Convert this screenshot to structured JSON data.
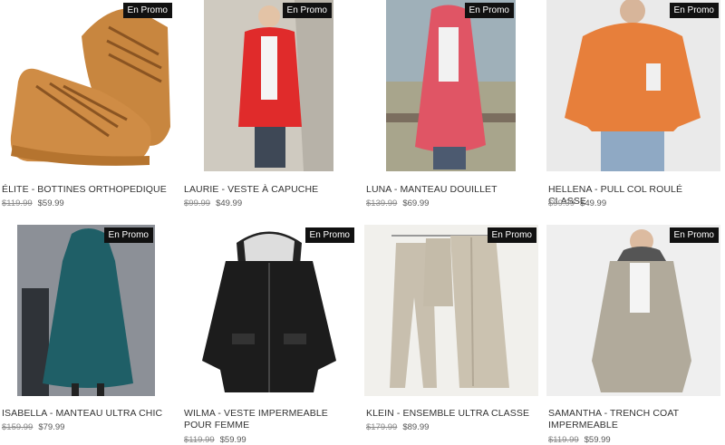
{
  "badge_label": "En Promo",
  "products": [
    {
      "title": "ÉLITE - BOTTINES ORTHOPEDIQUE",
      "old_price": "$119.99",
      "new_price": "$59.99"
    },
    {
      "title": "LAURIE - VESTE À CAPUCHE",
      "old_price": "$99.99",
      "new_price": "$49.99"
    },
    {
      "title": "LUNA - MANTEAU DOUILLET",
      "old_price": "$139.99",
      "new_price": "$69.99"
    },
    {
      "title": "HELLENA - PULL COL ROULÉ CLASSE",
      "old_price": "$99.99",
      "new_price": "$49.99"
    },
    {
      "title": "ISABELLA - MANTEAU ULTRA CHIC",
      "old_price": "$159.99",
      "new_price": "$79.99"
    },
    {
      "title": "WILMA - VESTE IMPERMEABLE POUR FEMME",
      "old_price": "$119.99",
      "new_price": "$59.99"
    },
    {
      "title": "KLEIN - ENSEMBLE ULTRA CLASSE",
      "old_price": "$179.99",
      "new_price": "$89.99"
    },
    {
      "title": "SAMANTHA - TRENCH COAT IMPERMEABLE",
      "old_price": "$119.99",
      "new_price": "$59.99"
    }
  ]
}
